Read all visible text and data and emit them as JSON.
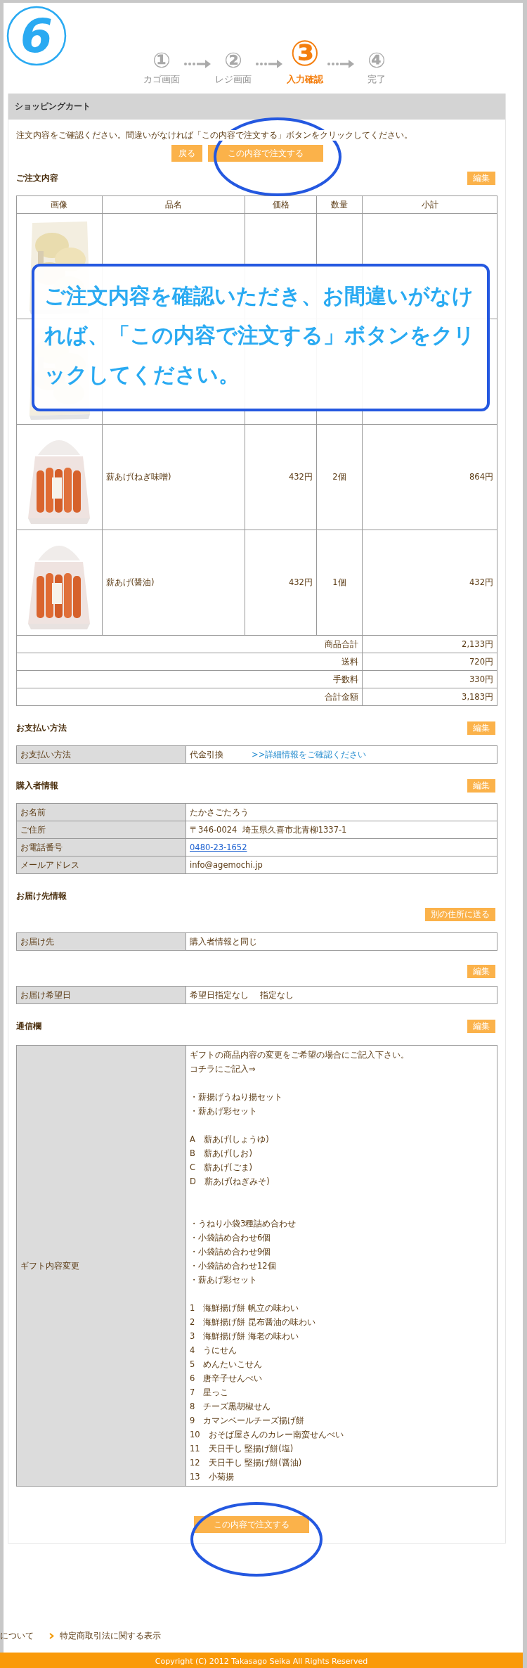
{
  "tutorial_step": "6",
  "steps": [
    {
      "number": "①",
      "label": "カゴ画面",
      "selected": false
    },
    {
      "number": "②",
      "label": "レジ画面",
      "selected": false
    },
    {
      "number": "③",
      "label": "入力確認",
      "selected": true
    },
    {
      "number": "④",
      "label": "完了",
      "selected": false
    }
  ],
  "cart": {
    "title": "ショッピングカート",
    "instruction": "注文内容をご確認ください。間違いがなければ「この内容で注文する」ボタンをクリックしてください。",
    "back_button": "戻る",
    "order_button": "この内容で注文する"
  },
  "order": {
    "heading": "ご注文内容",
    "edit_button": "編集",
    "columns": [
      "画像",
      "品名",
      "価格",
      "数量",
      "小計"
    ],
    "rows": [
      {
        "kind": "covered"
      },
      {
        "kind": "covered"
      },
      {
        "kind": "item",
        "name": "薪あげ(ねぎ味噌)",
        "price": "432円",
        "quantity": "2個",
        "subtotal": "864円"
      },
      {
        "kind": "item",
        "name": "薪あげ(醤油)",
        "price": "432円",
        "quantity": "1個",
        "subtotal": "432円"
      }
    ],
    "totals": [
      {
        "label": "商品合計",
        "value": "2,133円"
      },
      {
        "label": "送料",
        "value": "720円"
      },
      {
        "label": "手数料",
        "value": "330円"
      },
      {
        "label": "合計金額",
        "value": "3,183円"
      }
    ]
  },
  "payment": {
    "heading": "お支払い方法",
    "edit_button": "編集",
    "label": "お支払い方法",
    "value": "代金引換",
    "link": ">>詳細情報をご確認ください"
  },
  "buyer": {
    "heading": "購入者情報",
    "edit_button": "編集",
    "rows": [
      {
        "label": "お名前",
        "value": "たかさごたろう",
        "kind": "text"
      },
      {
        "label": "ご住所",
        "value": "〒346-0024  埼玉県久喜市北青柳1337-1",
        "kind": "text"
      },
      {
        "label": "お電話番号",
        "value": "0480-23-1652",
        "kind": "link"
      },
      {
        "label": "メールアドレス",
        "value": "info@agemochi.jp",
        "kind": "text"
      }
    ]
  },
  "delivery": {
    "heading": "お届け先情報",
    "other_address_button": "別の住所に送る",
    "label": "お届け先",
    "value": "購入者情報と同じ",
    "edit_button": "編集",
    "date_label": "お届け希望日",
    "date_value": "希望日指定なし　 指定なし"
  },
  "message": {
    "heading": "通信欄",
    "edit_button": "編集",
    "label": "ギフト内容変更",
    "blocks": [
      [
        "ギフトの商品内容の変更をご希望の場合にご記入下さい。",
        "コチラにご記入⇒"
      ],
      [
        "・薪揚げうねり揚セット",
        "・薪あげ彩セット"
      ],
      [
        "A　薪あげ(しょうゆ)",
        "B　薪あげ(しお)",
        "C　薪あげ(ごま)",
        "D　薪あげ(ねぎみそ)"
      ],
      [
        "・うねり小袋3種詰め合わせ",
        "・小袋詰め合わせ6個",
        "・小袋詰め合わせ9個",
        "・小袋詰め合わせ12個",
        "・薪あげ彩セット"
      ],
      [
        "1　海鮮揚げ餅 帆立の味わい",
        "2　海鮮揚げ餅 昆布醤油の味わい",
        "3　海鮮揚げ餅 海老の味わい",
        "4　うにせん",
        "5　めんたいこせん",
        "6　唐辛子せんべい",
        "7　星っこ",
        "8　チーズ黒胡椒せん",
        "9　カマンベールチーズ揚げ餅",
        "10　おそば屋さんのカレー南蛮せんべい",
        "11　天日干し 堅揚げ餅(塩)",
        "12　天日干し 堅揚げ餅(醤油)",
        "13　小菊揚"
      ]
    ]
  },
  "bottom_order_button": "この内容で注文する",
  "footer": {
    "links": [
      "について",
      "特定商取引法に関する表示"
    ],
    "copyright": "Copyright (C) 2012 Takasago Seika All Rights Reserved"
  },
  "callout": {
    "text": "ご注文内容を確認いただき、お間違いがなければ、「この内容で注文する」ボタンをクリックしてください。"
  }
}
